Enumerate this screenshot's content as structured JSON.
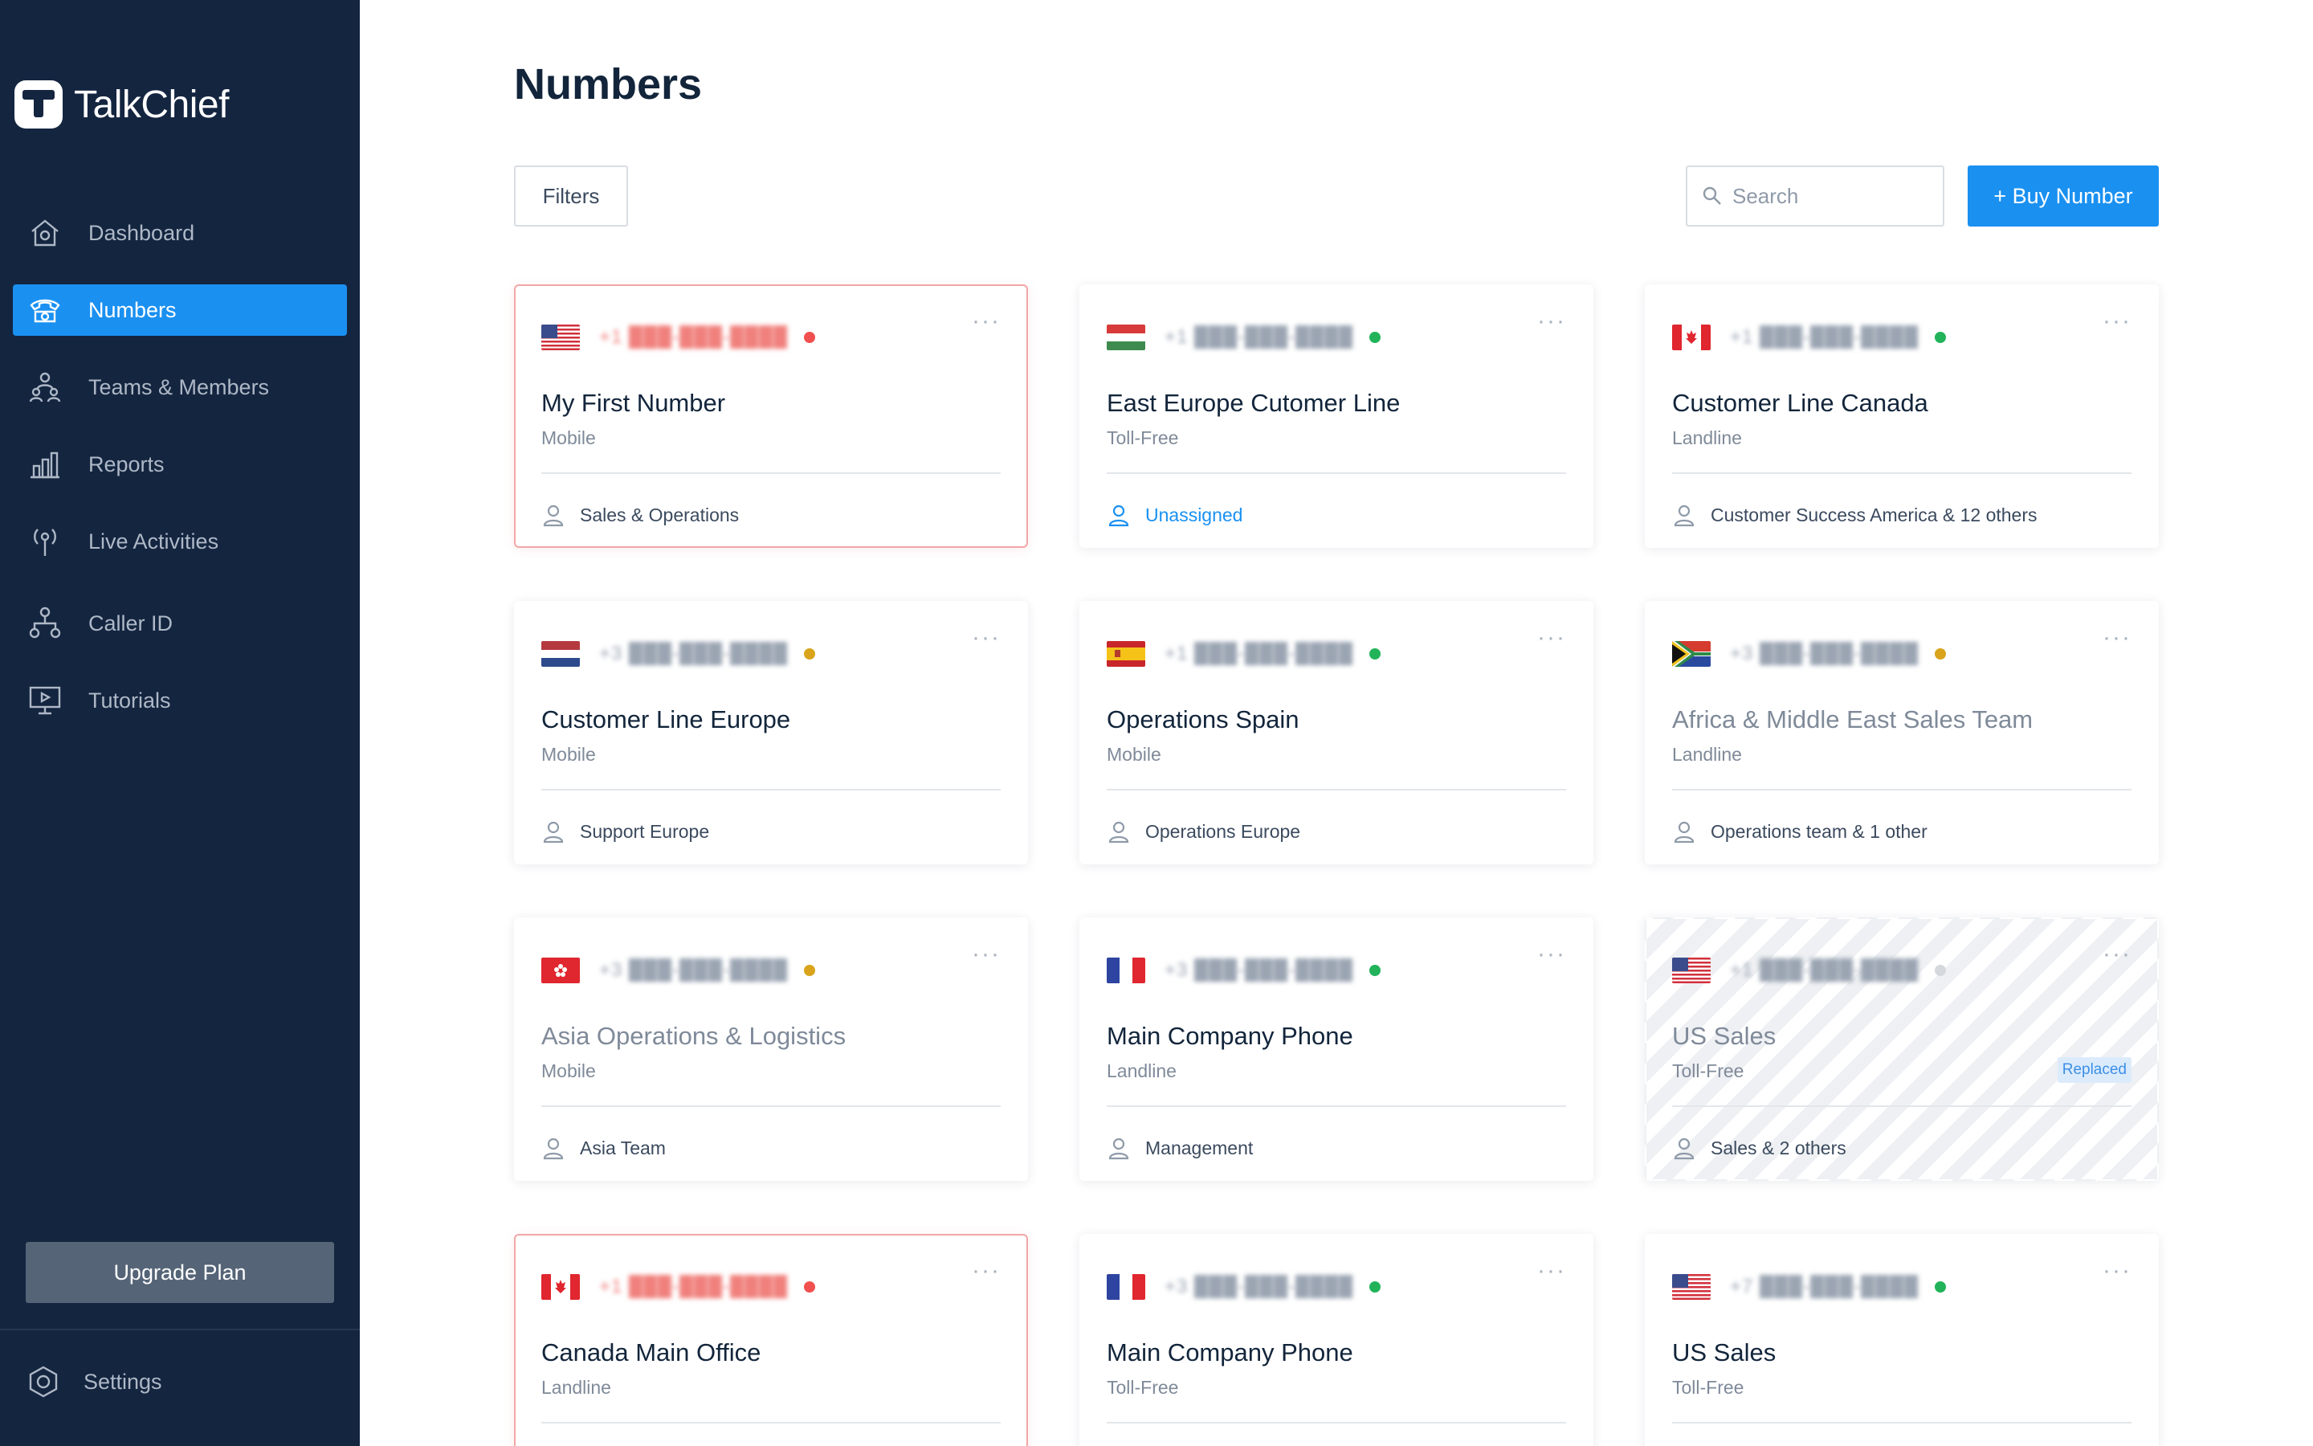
{
  "app": {
    "name": "TalkChief"
  },
  "sidebar": {
    "items": [
      {
        "label": "Dashboard",
        "icon": "home-icon"
      },
      {
        "label": "Numbers",
        "icon": "phone-icon",
        "active": true
      },
      {
        "label": "Teams & Members",
        "icon": "team-icon"
      },
      {
        "label": "Reports",
        "icon": "bar-chart-icon"
      },
      {
        "label": "Live Activities",
        "icon": "broadcast-icon"
      },
      {
        "label": "Caller ID",
        "icon": "hierarchy-icon"
      },
      {
        "label": "Tutorials",
        "icon": "monitor-icon"
      }
    ],
    "upgrade_label": "Upgrade Plan",
    "settings_label": "Settings"
  },
  "main": {
    "title": "Numbers",
    "filters_label": "Filters",
    "search_placeholder": "Search",
    "buy_label": "+ Buy Number"
  },
  "colors": {
    "sidebar_bg": "#142540",
    "accent": "#1a90f1",
    "status_red": "#f0504f",
    "status_green": "#22b35a",
    "status_yellow": "#d9a41c",
    "status_gray": "#d5d9de"
  },
  "cards": [
    {
      "flag": "us",
      "phone": "+1 ███-███-████",
      "status": "red",
      "name": "My First Number",
      "type": "Mobile",
      "assignee": "Sales & Operations",
      "alert": true
    },
    {
      "flag": "hu",
      "phone": "+1 ███-███-████",
      "status": "green",
      "name": "East Europe Cutomer Line",
      "type": "Toll-Free",
      "assignee": "Unassigned",
      "unassigned": true
    },
    {
      "flag": "ca",
      "phone": "+1 ███-███-████",
      "status": "green",
      "name": "Customer Line Canada",
      "type": "Landline",
      "assignee": "Customer Success America & 12 others"
    },
    {
      "flag": "nl",
      "phone": "+3 ███-███-████",
      "status": "yellow",
      "name": "Customer Line Europe",
      "type": "Mobile",
      "assignee": "Support Europe"
    },
    {
      "flag": "es",
      "phone": "+1 ███-███-████",
      "status": "green",
      "name": "Operations Spain",
      "type": "Mobile",
      "assignee": "Operations Europe"
    },
    {
      "flag": "za",
      "phone": "+3 ███-███-████",
      "status": "yellow",
      "name": "Africa & Middle East Sales Team",
      "type": "Landline",
      "assignee": "Operations team & 1 other",
      "muted": true
    },
    {
      "flag": "hk",
      "phone": "+3 ███-███-████",
      "status": "yellow",
      "name": "Asia Operations & Logistics",
      "type": "Mobile",
      "assignee": "Asia Team",
      "muted": true
    },
    {
      "flag": "fr",
      "phone": "+3 ███-███-████",
      "status": "green",
      "name": "Main Company Phone",
      "type": "Landline",
      "assignee": "Management"
    },
    {
      "flag": "us",
      "phone": "+1 ███-███-████",
      "status": "gray",
      "name": "US Sales",
      "type": "Toll-Free",
      "assignee": "Sales & 2 others",
      "replaced": true,
      "badge": "Replaced",
      "muted": true
    },
    {
      "flag": "ca",
      "phone": "+1 ███-███-████",
      "status": "red",
      "name": "Canada Main Office",
      "type": "Landline",
      "assignee": "",
      "alert": true
    },
    {
      "flag": "fr",
      "phone": "+3 ███-███-████",
      "status": "green",
      "name": "Main Company Phone",
      "type": "Toll-Free",
      "assignee": ""
    },
    {
      "flag": "us",
      "phone": "+7 ███-███-████",
      "status": "green",
      "name": "US Sales",
      "type": "Toll-Free",
      "assignee": ""
    }
  ]
}
